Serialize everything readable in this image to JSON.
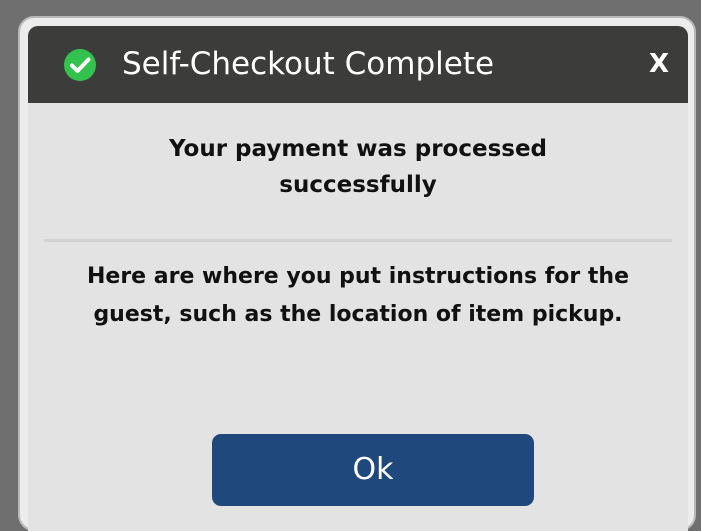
{
  "dialog": {
    "title": "Self-Checkout Complete",
    "close_label": "X",
    "message_lines": [
      "Your payment was processed",
      "successfully"
    ],
    "instruction_lines": [
      "Here are where you put instructions for the",
      "guest, such as the location of item pickup."
    ],
    "ok_label": "Ok",
    "icon": "check-circle-icon"
  },
  "colors": {
    "titlebar": "#3c3c3b",
    "success_icon": "#33c24d",
    "button": "#1f497d",
    "body": "#e3e3e3"
  }
}
